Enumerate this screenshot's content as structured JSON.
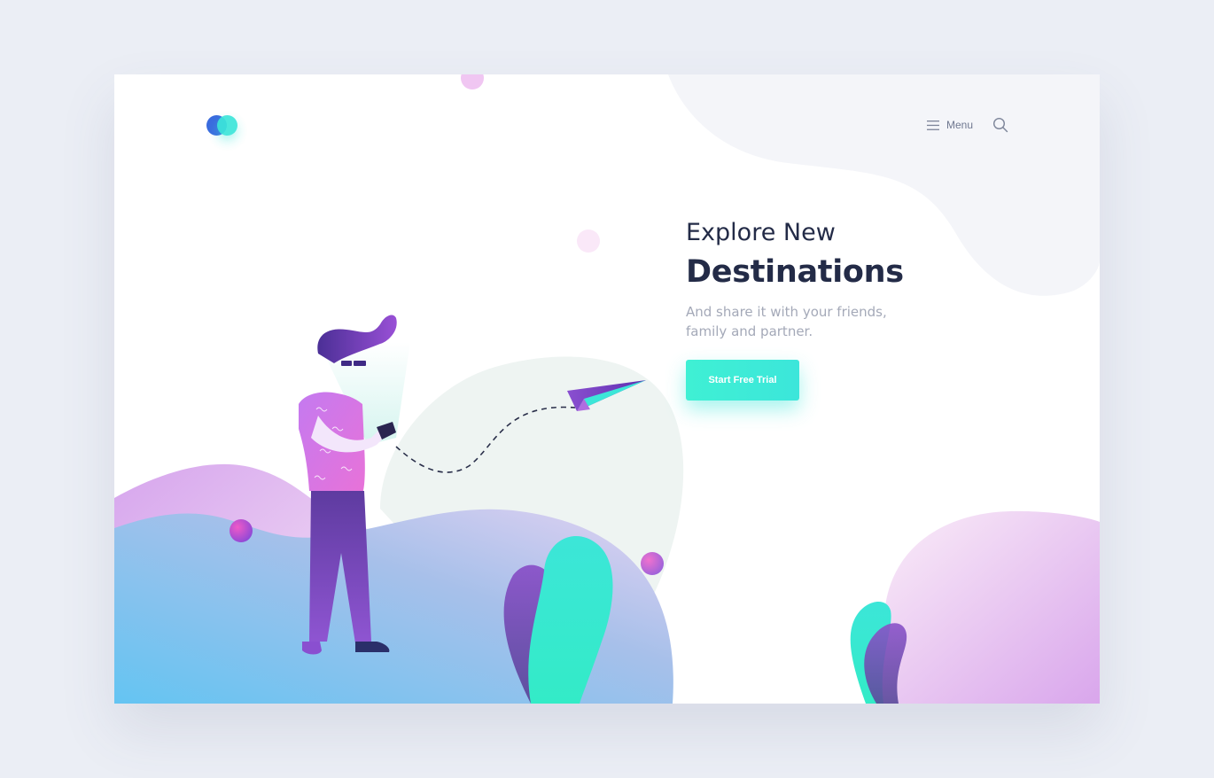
{
  "header": {
    "logo_icon": "twin-circles-logo",
    "menu_label": "Menu",
    "menu_icon": "hamburger-icon",
    "search_icon": "search-icon"
  },
  "hero": {
    "title_line1": "Explore New",
    "title_line2": "Destinations",
    "subtitle": "And share it with your friends, family and partner.",
    "cta_label": "Start Free Trial"
  },
  "colors": {
    "accent": "#3ce6da",
    "heading": "#232b47",
    "muted": "#a4a9b8",
    "purple": "#8a4fd0",
    "pink": "#d28bea",
    "blue": "#5ab8f0",
    "background": "#ebeef5"
  }
}
